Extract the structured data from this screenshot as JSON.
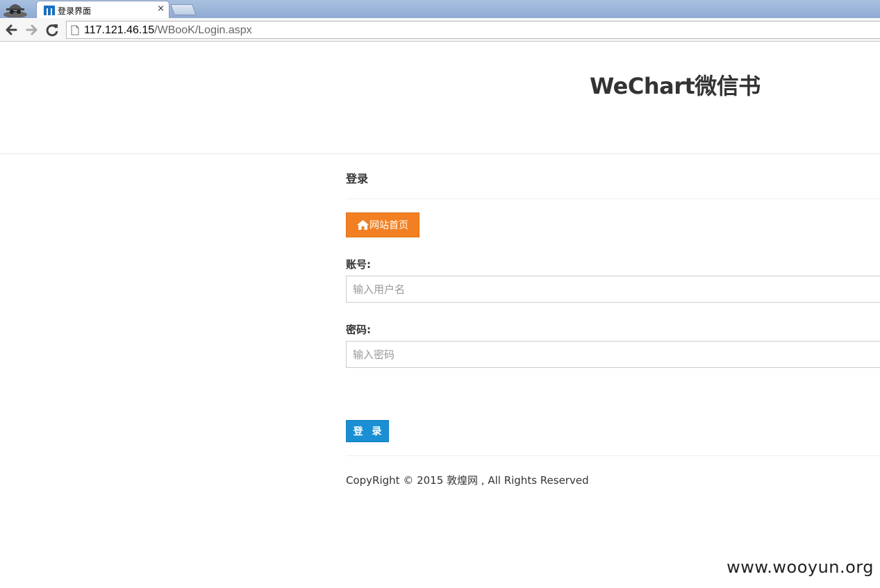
{
  "browser": {
    "tab": {
      "title": "登录界面",
      "close_glyph": "×",
      "favicon": "site-logo-icon"
    },
    "address": {
      "host": "117.121.46.15",
      "path": "/WBooK/Login.aspx"
    },
    "icons": [
      "incognito-icon",
      "back-arrow-icon",
      "forward-arrow-icon",
      "reload-icon",
      "page-icon"
    ]
  },
  "header": {
    "site_title": "WeChart微信书"
  },
  "login": {
    "section_title": "登录",
    "home_button": {
      "label": "网站首页",
      "icon": "home-icon"
    },
    "username": {
      "label": "账号:",
      "placeholder": "输入用户名",
      "value": ""
    },
    "password": {
      "label": "密码:",
      "placeholder": "输入密码",
      "value": ""
    },
    "submit_label": "登 录"
  },
  "footer": {
    "copyright": "CopyRight © 2015 敦煌网 , All Rights Reserved"
  },
  "watermark": "www.wooyun.org",
  "colors": {
    "home_button": "#f28022",
    "login_button": "#1a8fd3"
  }
}
